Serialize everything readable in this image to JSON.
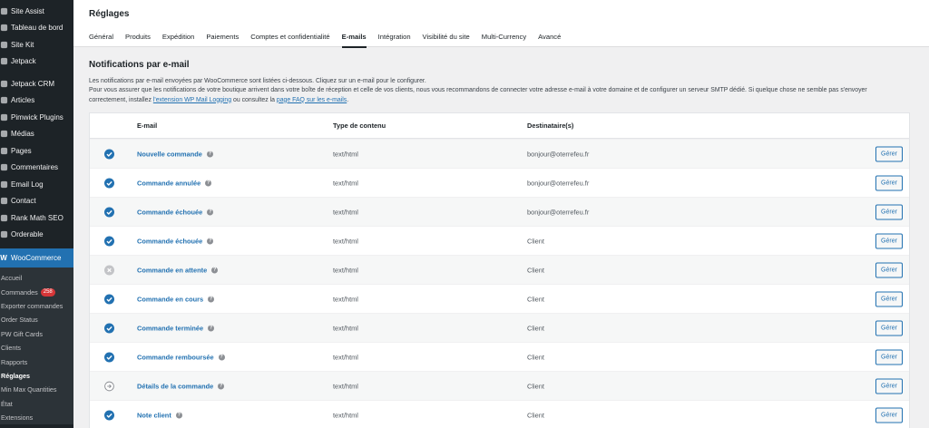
{
  "sidebar": {
    "items": [
      {
        "label": "Site Assist",
        "icon": "site-assist-icon"
      },
      {
        "label": "Tableau de bord",
        "icon": "dashboard-icon"
      },
      {
        "label": "Site Kit",
        "icon": "sitekit-icon"
      },
      {
        "label": "Jetpack",
        "icon": "jetpack-icon"
      },
      {
        "label": "Jetpack CRM",
        "icon": "crm-icon"
      },
      {
        "label": "Articles",
        "icon": "pin-icon"
      },
      {
        "label": "Pimwick Plugins",
        "icon": "plugin-icon"
      },
      {
        "label": "Médias",
        "icon": "media-icon"
      },
      {
        "label": "Pages",
        "icon": "pages-icon"
      },
      {
        "label": "Commentaires",
        "icon": "comments-icon"
      },
      {
        "label": "Email Log",
        "icon": "email-icon"
      },
      {
        "label": "Contact",
        "icon": "contact-icon"
      },
      {
        "label": "Rank Math SEO",
        "icon": "rankmath-icon"
      },
      {
        "label": "Orderable",
        "icon": "orderable-icon"
      }
    ],
    "woocommerce": {
      "label": "WooCommerce",
      "icon_text": "W"
    },
    "submenu": [
      {
        "label": "Accueil"
      },
      {
        "label": "Commandes",
        "badge": "258"
      },
      {
        "label": "Exporter commandes"
      },
      {
        "label": "Order Status"
      },
      {
        "label": "PW Gift Cards"
      },
      {
        "label": "Clients"
      },
      {
        "label": "Rapports"
      },
      {
        "label": "Réglages",
        "current": true
      },
      {
        "label": "Min Max Quantities"
      },
      {
        "label": "État"
      },
      {
        "label": "Extensions"
      }
    ]
  },
  "header": {
    "title": "Réglages",
    "tabs": [
      "Général",
      "Produits",
      "Expédition",
      "Paiements",
      "Comptes et confidentialité",
      "E-mails",
      "Intégration",
      "Visibilité du site",
      "Multi-Currency",
      "Avancé"
    ],
    "active_tab": "E-mails"
  },
  "section": {
    "title": "Notifications par e-mail",
    "line1": "Les notifications par e-mail envoyées par WooCommerce sont listées ci-dessous. Cliquez sur un e-mail pour le configurer.",
    "line2": "Pour vous assurer que les notifications de votre boutique arrivent dans votre boîte de réception et celle de vos clients, nous vous recommandons de connecter votre adresse e-mail à votre domaine et de configurer un serveur SMTP dédié. Si quelque chose ne semble pas s'envoyer",
    "line3_pre": "correctement, installez ",
    "link1": "l'extension WP Mail Logging",
    "line3_mid": " ou consultez la ",
    "link2": "page FAQ sur les e-mails",
    "line3_post": "."
  },
  "table": {
    "headers": {
      "name": "E-mail",
      "type": "Type de contenu",
      "dest": "Destinataire(s)"
    },
    "button_label": "Gérer",
    "rows": [
      {
        "name": "Nouvelle commande",
        "type": "text/html",
        "dest": "bonjour@oterrefeu.fr",
        "status": "enabled"
      },
      {
        "name": "Commande annulée",
        "type": "text/html",
        "dest": "bonjour@oterrefeu.fr",
        "status": "enabled"
      },
      {
        "name": "Commande échouée",
        "type": "text/html",
        "dest": "bonjour@oterrefeu.fr",
        "status": "enabled"
      },
      {
        "name": "Commande échouée",
        "type": "text/html",
        "dest": "Client",
        "status": "enabled"
      },
      {
        "name": "Commande en attente",
        "type": "text/html",
        "dest": "Client",
        "status": "disabled"
      },
      {
        "name": "Commande en cours",
        "type": "text/html",
        "dest": "Client",
        "status": "enabled"
      },
      {
        "name": "Commande terminée",
        "type": "text/html",
        "dest": "Client",
        "status": "enabled"
      },
      {
        "name": "Commande remboursée",
        "type": "text/html",
        "dest": "Client",
        "status": "enabled"
      },
      {
        "name": "Détails de la commande",
        "type": "text/html",
        "dest": "Client",
        "status": "manual"
      },
      {
        "name": "Note client",
        "type": "text/html",
        "dest": "Client",
        "status": "enabled"
      }
    ]
  },
  "colors": {
    "accent": "#2271b1",
    "sidebar_bg": "#1d2327",
    "badge": "#d63638"
  }
}
